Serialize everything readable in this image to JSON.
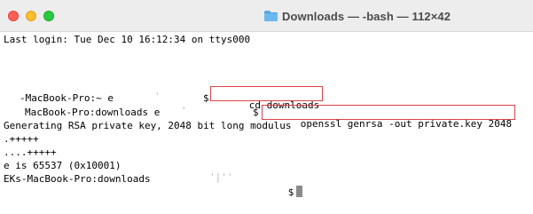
{
  "window": {
    "title": "Downloads — -bash — 112×42"
  },
  "terminal": {
    "last_login": "Last login: Tue Dec 10 16:12:34 on ttys000",
    "line1_host": "-MacBook-Pro:~ e",
    "line1_faint": "'",
    "line1_prompt": "$",
    "line1_command": "cd downloads",
    "line2_host": "MacBook-Pro:downloads e",
    "line2_faint": "'",
    "line2_prompt": "$",
    "line2_command": "openssl genrsa -out private.key 2048",
    "output1": "Generating RSA private key, 2048 bit long modulus",
    "output2": ".+++++",
    "output3": "....+++++",
    "output4": "e is 65537 (0x10001)",
    "line3_host": "EKs-MacBook-Pro:downloads",
    "line3_faint": "'|''",
    "line3_prompt": "$"
  },
  "colors": {
    "highlight_box": "#e0434b",
    "titlebar": "#ededed",
    "cursor": "#8a8a8a"
  }
}
